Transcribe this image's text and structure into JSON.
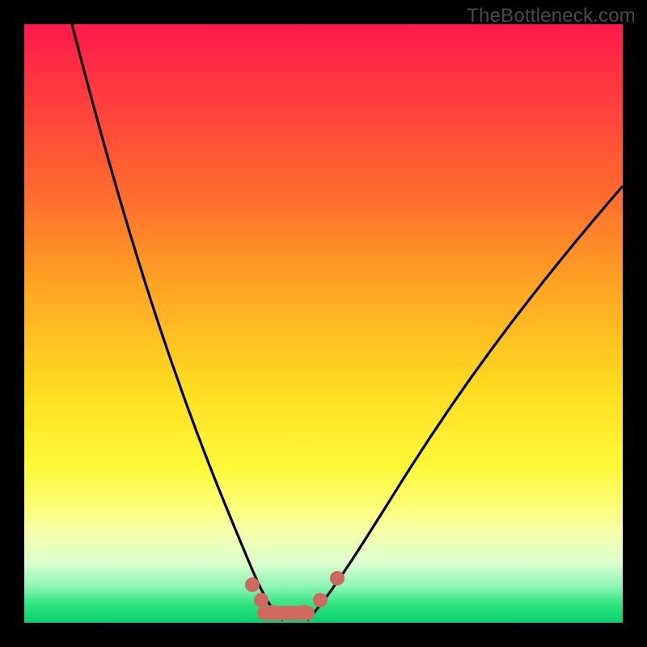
{
  "watermark": "TheBottleneck.com",
  "chart_data": {
    "type": "line",
    "title": "",
    "xlabel": "",
    "ylabel": "",
    "xlim": [
      0,
      100
    ],
    "ylim": [
      0,
      100
    ],
    "grid": false,
    "legend": false,
    "series": [
      {
        "name": "left-curve",
        "x": [
          8,
          12,
          17,
          22,
          27,
          31,
          34,
          36,
          38,
          40,
          42
        ],
        "y": [
          100,
          81,
          63,
          47,
          33,
          22,
          14,
          10,
          6,
          3,
          1
        ]
      },
      {
        "name": "right-curve",
        "x": [
          47,
          50,
          54,
          59,
          65,
          72,
          80,
          89,
          100
        ],
        "y": [
          1,
          4,
          9,
          16,
          25,
          35,
          47,
          59,
          73
        ]
      }
    ],
    "optimum_band_x": [
      40,
      47
    ],
    "markers": [
      {
        "x": 38,
        "y": 6
      },
      {
        "x": 40,
        "y": 3
      },
      {
        "x": 42,
        "y": 1
      },
      {
        "x": 47,
        "y": 1
      },
      {
        "x": 50,
        "y": 4
      },
      {
        "x": 53,
        "y": 8
      }
    ],
    "background_gradient": {
      "top": "#ff1a4b",
      "mid": "#ffdf22",
      "bottom": "#0ccf6e"
    }
  }
}
